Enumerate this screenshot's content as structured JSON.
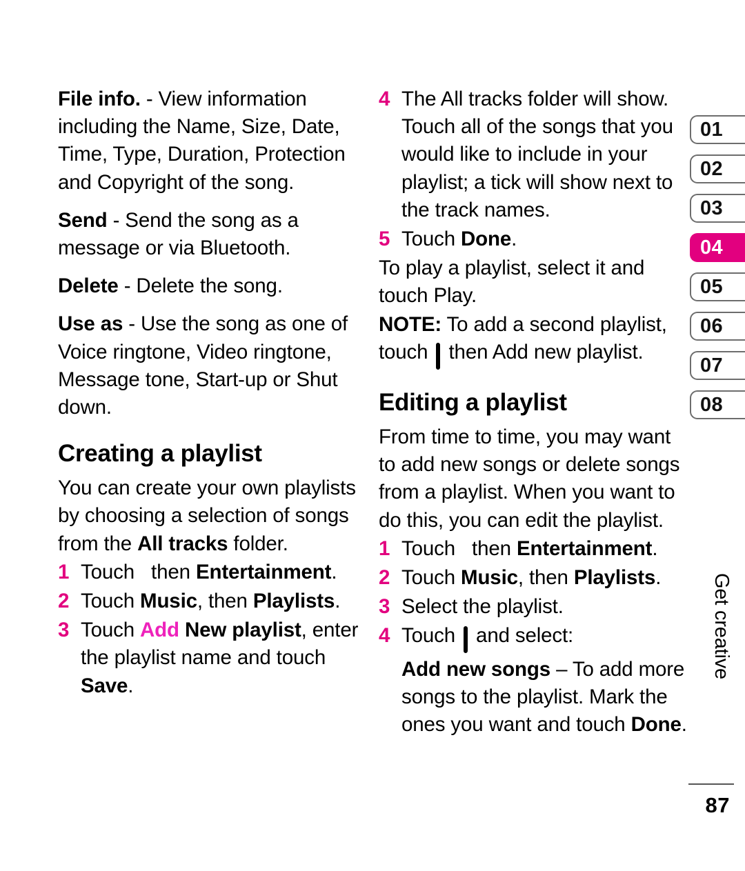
{
  "page": {
    "folio": "87",
    "chapter_label": "Get creative"
  },
  "colors": {
    "accent_magenta": "#e2007f",
    "link_magenta": "#ee22bb",
    "icon_blue": "#1351d8"
  },
  "tabs": [
    {
      "label": "01",
      "active": false
    },
    {
      "label": "02",
      "active": false
    },
    {
      "label": "03",
      "active": false
    },
    {
      "label": "04",
      "active": true
    },
    {
      "label": "05",
      "active": false
    },
    {
      "label": "06",
      "active": false
    },
    {
      "label": "07",
      "active": false
    },
    {
      "label": "08",
      "active": false
    }
  ],
  "icons": {
    "grid": "menu-grid-icon",
    "options": "options-menu-icon"
  },
  "left_column": {
    "file_info_term": "File info.",
    "file_info_body": " - View information including the Name, Size, Date, Time, Type, Duration, Protection and Copyright of the song.",
    "send_term": "Send",
    "send_body": " - Send the song as a message or via Bluetooth.",
    "delete_term": "Delete",
    "delete_body": " - Delete the song.",
    "use_as_term": "Use as",
    "use_as_body": " - Use the song as one of Voice ringtone, Video ringtone, Message tone, Start-up or Shut down.",
    "heading": "Creating a playlist",
    "intro_a": "You can create your own playlists by choosing a selection of songs from the ",
    "intro_bold": "All tracks",
    "intro_b": " folder.",
    "steps": [
      {
        "num": "1",
        "parts": [
          {
            "text": "Touch ",
            "style": "normal"
          },
          {
            "text": "",
            "style": "icon-grid"
          },
          {
            "text": " then ",
            "style": "normal"
          },
          {
            "text": "Entertainment",
            "style": "bold"
          },
          {
            "text": ".",
            "style": "normal"
          }
        ]
      },
      {
        "num": "2",
        "parts": [
          {
            "text": "Touch ",
            "style": "normal"
          },
          {
            "text": "Music",
            "style": "bold"
          },
          {
            "text": ", then ",
            "style": "normal"
          },
          {
            "text": "Playlists",
            "style": "bold"
          },
          {
            "text": ".",
            "style": "normal"
          }
        ]
      },
      {
        "num": "3",
        "parts": [
          {
            "text": "Touch ",
            "style": "normal"
          },
          {
            "text": "Add",
            "style": "magenta"
          },
          {
            "text": " New playlist",
            "style": "bold"
          },
          {
            "text": ", enter the playlist name and touch ",
            "style": "normal"
          },
          {
            "text": "Save",
            "style": "bold"
          },
          {
            "text": ".",
            "style": "normal"
          }
        ]
      }
    ]
  },
  "right_column": {
    "step4_num": "4",
    "step4_text": "The All tracks folder will show. Touch all of the songs that you would like to include in your playlist; a tick will show next to the track names.",
    "step5_num": "5",
    "step5_a": "Touch ",
    "step5_bold": "Done",
    "step5_b": ".",
    "play_note": "To play a playlist, select it and touch Play.",
    "note_label": "NOTE:",
    "note_a": " To add a second playlist, touch ",
    "note_b": " then Add new playlist.",
    "heading": "Editing a playlist",
    "intro": "From time to time, you may want to add new songs or delete songs from a playlist. When you want to do this, you can edit the playlist.",
    "steps": [
      {
        "num": "1",
        "parts": [
          {
            "text": "Touch ",
            "style": "normal"
          },
          {
            "text": "",
            "style": "icon-grid"
          },
          {
            "text": " then ",
            "style": "normal"
          },
          {
            "text": "Entertainment",
            "style": "bold"
          },
          {
            "text": ".",
            "style": "normal"
          }
        ]
      },
      {
        "num": "2",
        "parts": [
          {
            "text": "Touch ",
            "style": "normal"
          },
          {
            "text": "Music",
            "style": "bold"
          },
          {
            "text": ", then ",
            "style": "normal"
          },
          {
            "text": "Playlists",
            "style": "bold"
          },
          {
            "text": ".",
            "style": "normal"
          }
        ]
      },
      {
        "num": "3",
        "parts": [
          {
            "text": "Select the playlist.",
            "style": "normal"
          }
        ]
      },
      {
        "num": "4",
        "parts": [
          {
            "text": "Touch ",
            "style": "normal"
          },
          {
            "text": "",
            "style": "icon-menu"
          },
          {
            "text": " and select:",
            "style": "normal"
          }
        ]
      }
    ],
    "add_new_songs_term": "Add new songs",
    "add_new_songs_body": " – To add more songs to the playlist. Mark the ones you want and touch ",
    "add_new_songs_done": "Done",
    "add_new_songs_end": "."
  }
}
